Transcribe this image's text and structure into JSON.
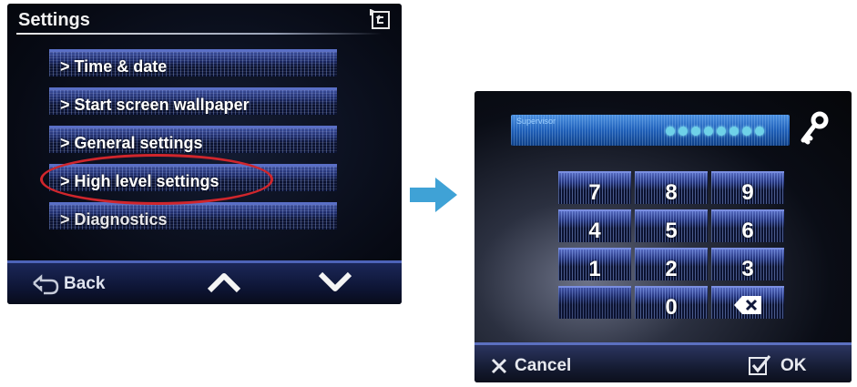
{
  "left_screen": {
    "title": "Settings",
    "menu_items": [
      {
        "label": "> Time & date"
      },
      {
        "label": "> Start screen wallpaper"
      },
      {
        "label": "> General settings"
      },
      {
        "label": "> High level settings"
      },
      {
        "label": "> Diagnostics"
      }
    ],
    "highlighted_item": "> High level settings",
    "back_label": "Back",
    "icons": {
      "title_back": "return-icon",
      "back": "back-arrow-icon",
      "up": "chevron-up-icon",
      "down": "chevron-down-icon"
    }
  },
  "transition": {
    "icon": "arrow-right-icon",
    "color": "#3fa2d6"
  },
  "right_screen": {
    "pin_label": "Supervisor",
    "pin_dot_count": 8,
    "keys": [
      "7",
      "8",
      "9",
      "4",
      "5",
      "6",
      "1",
      "2",
      "3",
      "0"
    ],
    "cancel_label": "Cancel",
    "ok_label": "OK",
    "icons": {
      "key": "key-icon",
      "backspace": "backspace-icon",
      "cancel": "x-icon",
      "ok": "checkbox-icon"
    }
  },
  "colors": {
    "highlight_ellipse": "#d0262c",
    "pin_field": "#1f5fb8",
    "button_gradient_top": "#5368be"
  }
}
